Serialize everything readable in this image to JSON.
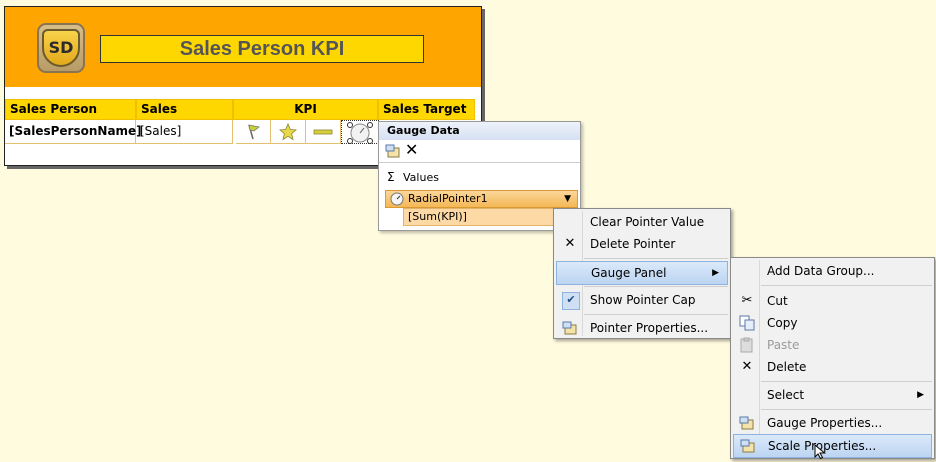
{
  "report": {
    "logo_text": "SD",
    "title": "Sales Person KPI",
    "headers": [
      "Sales Person",
      "Sales",
      "KPI",
      "Sales Target"
    ],
    "row": {
      "sales_person": "[SalesPersonName]",
      "sales": "[Sales]"
    },
    "kpi_icons": [
      "flag-icon",
      "star-icon",
      "bar-icon",
      "radial-gauge-icon"
    ]
  },
  "gauge_data": {
    "title": "Gauge Data",
    "values_label": "Values",
    "pointer": "RadialPointer1",
    "pointer_value": "[Sum(KPI)]"
  },
  "menu1": {
    "items": [
      {
        "label": "Clear Pointer Value",
        "icon": ""
      },
      {
        "label": "Delete Pointer",
        "icon": "delete-icon"
      },
      {
        "label": "Gauge Panel",
        "icon": "",
        "submenu": true
      },
      {
        "label": "Show Pointer Cap",
        "icon": "checkmark-icon"
      },
      {
        "label": "Pointer Properties...",
        "icon": "properties-icon"
      }
    ]
  },
  "menu2": {
    "items": [
      {
        "label": "Add Data Group...",
        "icon": ""
      },
      {
        "label": "Cut",
        "icon": "cut-icon"
      },
      {
        "label": "Copy",
        "icon": "copy-icon"
      },
      {
        "label": "Paste",
        "icon": "paste-icon",
        "disabled": true
      },
      {
        "label": "Delete",
        "icon": "delete-icon"
      },
      {
        "label": "Select",
        "icon": "",
        "submenu": true
      },
      {
        "label": "Gauge Properties...",
        "icon": "properties-icon"
      },
      {
        "label": "Scale Properties...",
        "icon": "properties-icon"
      }
    ]
  },
  "colors": {
    "banner": "#ffa500",
    "header": "#ffd700",
    "highlight": "#bcd5f2"
  }
}
